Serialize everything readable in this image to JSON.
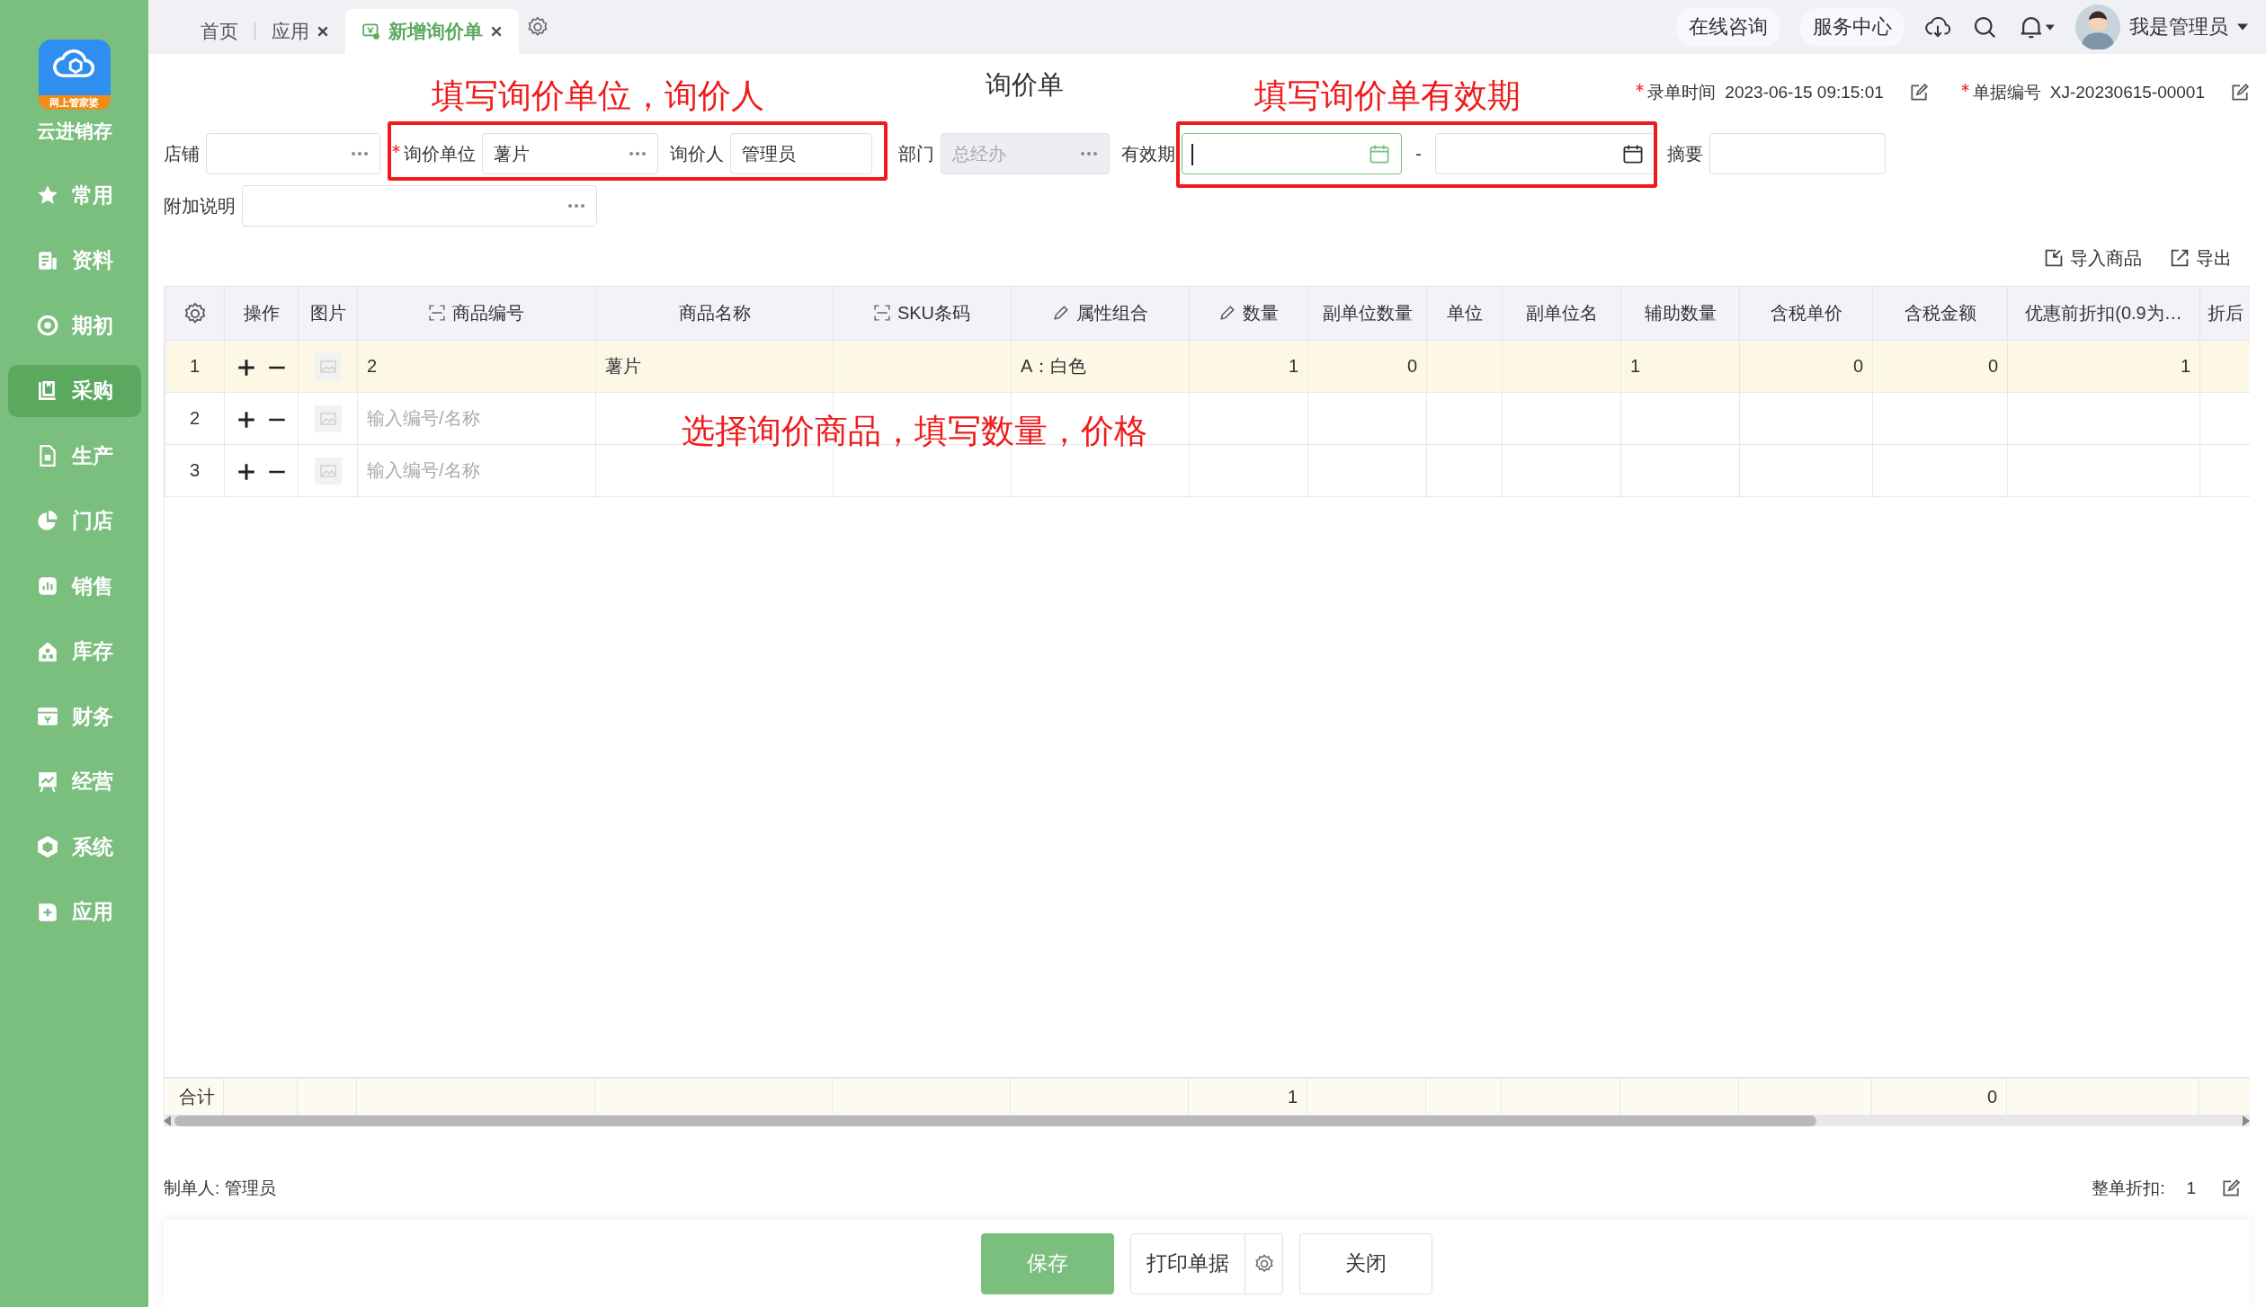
{
  "sidebar": {
    "logo_badge": "网上管家婆",
    "app_name": "云进销存",
    "items": [
      {
        "label": "常用",
        "selected": false
      },
      {
        "label": "资料",
        "selected": false
      },
      {
        "label": "期初",
        "selected": false
      },
      {
        "label": "采购",
        "selected": true
      },
      {
        "label": "生产",
        "selected": false
      },
      {
        "label": "门店",
        "selected": false
      },
      {
        "label": "销售",
        "selected": false
      },
      {
        "label": "库存",
        "selected": false
      },
      {
        "label": "财务",
        "selected": false
      },
      {
        "label": "经营",
        "selected": false
      },
      {
        "label": "系统",
        "selected": false
      },
      {
        "label": "应用",
        "selected": false
      }
    ]
  },
  "tabs": [
    {
      "label": "首页",
      "closable": false,
      "selected": false
    },
    {
      "label": "应用",
      "closable": true,
      "selected": false
    },
    {
      "label": "新增询价单",
      "closable": true,
      "selected": true
    }
  ],
  "header_links": [
    "在线咨询",
    "服务中心"
  ],
  "user": {
    "name": "我是管理员"
  },
  "form": {
    "title": "询价单",
    "meta": [
      {
        "label": "录单时间",
        "value": "2023-06-15 09:15:01",
        "required": true
      },
      {
        "label": "单据编号",
        "value": "XJ-20230615-00001",
        "required": true
      }
    ],
    "rows": [
      [
        {
          "label": "店铺",
          "kind": "picker",
          "required": false,
          "disabled": false
        },
        {
          "label": "询价单位",
          "kind": "picker",
          "value": "薯片",
          "required": true,
          "disabled": false
        },
        {
          "label": "询价人",
          "kind": "text",
          "value": "管理员",
          "required": false,
          "disabled": false
        },
        {
          "label": "部门",
          "kind": "picker",
          "placeholder": "总经办",
          "required": false,
          "disabled": true
        },
        {
          "label": "有效期",
          "kind": "date_range",
          "separator": "-",
          "focused": true,
          "required": false,
          "disabled": false
        },
        {
          "label": "摘要",
          "kind": "text",
          "required": false,
          "disabled": false
        }
      ],
      [
        {
          "label": "附加说明",
          "kind": "picker",
          "required": false,
          "disabled": false
        }
      ]
    ]
  },
  "toolbar": [
    {
      "label": "导入商品",
      "kind": "import"
    },
    {
      "label": "导出",
      "kind": "export"
    }
  ],
  "table": {
    "columns": [
      {
        "kind": "settings"
      },
      {
        "label": "操作",
        "kind": "actions"
      },
      {
        "label": "图片",
        "kind": "image"
      },
      {
        "label": "商品编号",
        "kind": "data",
        "scannable": true,
        "editable": false
      },
      {
        "label": "商品名称",
        "kind": "data",
        "scannable": false,
        "editable": false
      },
      {
        "label": "SKU条码",
        "kind": "data",
        "scannable": true,
        "editable": false
      },
      {
        "label": "属性组合",
        "kind": "data",
        "scannable": false,
        "editable": true
      },
      {
        "label": "数量",
        "kind": "data",
        "scannable": false,
        "editable": true
      },
      {
        "label": "副单位数量",
        "kind": "data",
        "scannable": false,
        "editable": false
      },
      {
        "label": "单位",
        "kind": "data",
        "scannable": false,
        "editable": false
      },
      {
        "label": "副单位名",
        "kind": "data",
        "scannable": false,
        "editable": false
      },
      {
        "label": "辅助数量",
        "kind": "data",
        "scannable": false,
        "editable": false
      },
      {
        "label": "含税单价",
        "kind": "data",
        "scannable": false,
        "editable": false
      },
      {
        "label": "含税金额",
        "kind": "data",
        "scannable": false,
        "editable": false
      },
      {
        "label": "优惠前折扣(0.9为…",
        "kind": "data",
        "scannable": false,
        "editable": false
      },
      {
        "label": "折后",
        "kind": "data",
        "scannable": false,
        "editable": false
      }
    ],
    "rows": [
      {
        "highlighted": true,
        "cells": [
          "1",
          null,
          null,
          "2",
          "薯片",
          null,
          "A：白色",
          "1",
          "0",
          null,
          null,
          "1",
          "0",
          "0",
          "1",
          null
        ]
      },
      {
        "highlighted": false,
        "placeholder": "输入编号/名称",
        "cells": [
          "2",
          null,
          null,
          null,
          null,
          null,
          null,
          null,
          null,
          null,
          null,
          null,
          null,
          null,
          null,
          null
        ]
      },
      {
        "highlighted": false,
        "placeholder": "输入编号/名称",
        "cells": [
          "3",
          null,
          null,
          null,
          null,
          null,
          null,
          null,
          null,
          null,
          null,
          null,
          null,
          null,
          null,
          null
        ]
      }
    ],
    "totals": {
      "cells": [
        "合计",
        null,
        null,
        null,
        null,
        null,
        null,
        "1",
        null,
        null,
        null,
        null,
        null,
        "0",
        null,
        null
      ]
    }
  },
  "footer": {
    "maker": "制单人: 管理员",
    "discount_label": "整单折扣:",
    "discount_value": "1"
  },
  "buttons": [
    {
      "label": "保存",
      "kind": "primary"
    },
    {
      "label": "打印单据",
      "kind": "split"
    },
    {
      "label": "关闭",
      "kind": "default"
    }
  ],
  "annotations": [
    "填写询价单位，询价人",
    "填写询价单有效期",
    "选择询价商品，填写数量，价格"
  ]
}
